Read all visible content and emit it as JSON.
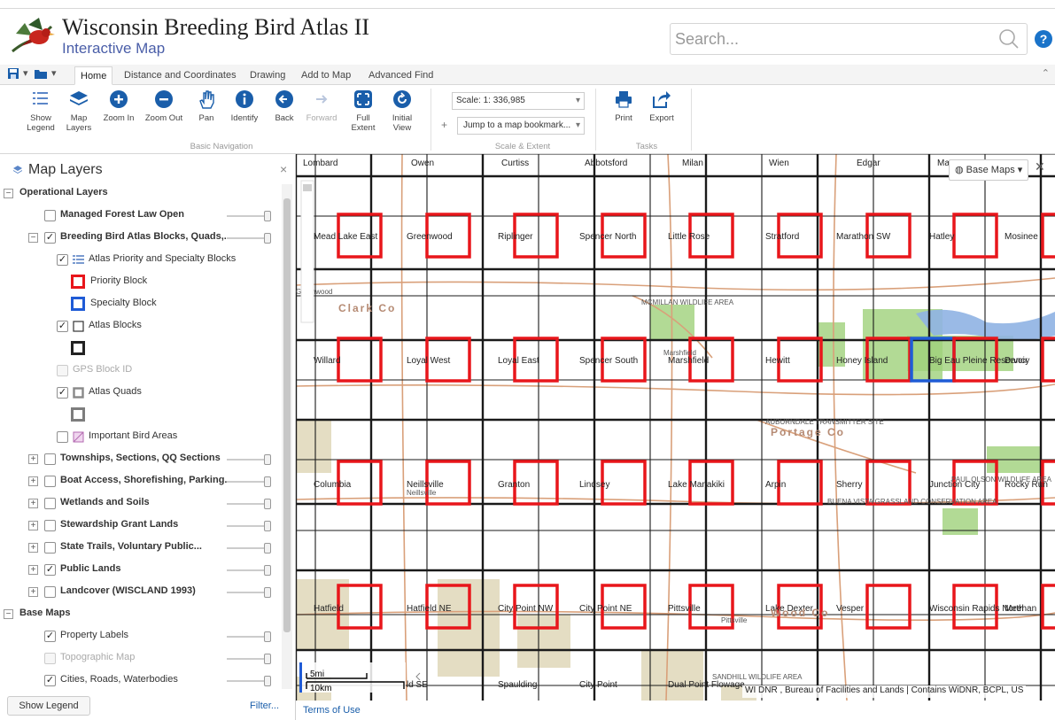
{
  "app": {
    "title": "Wisconsin Breeding Bird Atlas II",
    "subtitle": "Interactive Map"
  },
  "search": {
    "placeholder": "Search..."
  },
  "help": {
    "label": "?"
  },
  "tabs": [
    {
      "label": "Home"
    },
    {
      "label": "Distance and Coordinates"
    },
    {
      "label": "Drawing"
    },
    {
      "label": "Add to Map"
    },
    {
      "label": "Advanced Find"
    }
  ],
  "ribbon": {
    "nav": [
      {
        "label": "Show Legend",
        "icon": "legend-icon"
      },
      {
        "label": "Map Layers",
        "icon": "layers-icon"
      },
      {
        "label": "Zoom In",
        "icon": "zoom-in-icon"
      },
      {
        "label": "Zoom Out",
        "icon": "zoom-out-icon"
      },
      {
        "label": "Pan",
        "icon": "pan-hand-icon"
      },
      {
        "label": "Identify",
        "icon": "info-icon"
      },
      {
        "label": "Back",
        "icon": "back-arrow-icon"
      },
      {
        "label": "Forward",
        "icon": "forward-arrow-icon"
      },
      {
        "label": "Full Extent",
        "icon": "full-extent-icon"
      },
      {
        "label": "Initial View",
        "icon": "initial-view-icon"
      }
    ],
    "nav_group": "Basic Navigation",
    "scale_label": "Scale: 1:",
    "scale_value": "336,985",
    "bookmark": "Jump to a map bookmark...",
    "scale_group": "Scale & Extent",
    "tasks": [
      {
        "label": "Print",
        "icon": "print-icon"
      },
      {
        "label": "Export",
        "icon": "export-icon"
      }
    ],
    "tasks_group": "Tasks"
  },
  "panel": {
    "title": "Map Layers",
    "close": "×",
    "show_legend": "Show Legend",
    "filter": "Filter...",
    "rows": [
      {
        "type": "group",
        "label": "Operational Layers",
        "exp": "−"
      },
      {
        "type": "layer",
        "label": "Managed Forest Law Open",
        "checked": false,
        "slider": true
      },
      {
        "type": "layer",
        "label": "Breeding Bird Atlas Blocks, Quads,...",
        "checked": true,
        "slider": true,
        "exp": "−"
      },
      {
        "type": "sub",
        "label": "Atlas Priority and Specialty Blocks",
        "checked": true
      },
      {
        "type": "legend",
        "label": "Priority Block",
        "color": "#e8161b"
      },
      {
        "type": "legend",
        "label": "Specialty Block",
        "color": "#1f5bd6"
      },
      {
        "type": "sub",
        "label": "Atlas Blocks",
        "checked": true
      },
      {
        "type": "legend",
        "label": "",
        "color": "#222222"
      },
      {
        "type": "sub",
        "label": "GPS Block ID",
        "checked": false,
        "dim": true
      },
      {
        "type": "sub",
        "label": "Atlas Quads",
        "checked": true
      },
      {
        "type": "legend",
        "label": "",
        "color": "#7d7d7d"
      },
      {
        "type": "sub",
        "label": "Important Bird Areas",
        "checked": false
      },
      {
        "type": "layer",
        "label": "Townships, Sections, QQ Sections",
        "checked": false,
        "slider": true,
        "exp": "+"
      },
      {
        "type": "layer",
        "label": "Boat Access, Shorefishing, Parking...",
        "checked": false,
        "slider": true,
        "exp": "+"
      },
      {
        "type": "layer",
        "label": "Wetlands and Soils",
        "checked": false,
        "slider": true,
        "exp": "+"
      },
      {
        "type": "layer",
        "label": "Stewardship Grant Lands",
        "checked": false,
        "slider": true,
        "exp": "+"
      },
      {
        "type": "layer",
        "label": "State Trails, Voluntary Public...",
        "checked": false,
        "slider": true,
        "exp": "+"
      },
      {
        "type": "layer",
        "label": "Public Lands",
        "checked": true,
        "slider": true,
        "exp": "+"
      },
      {
        "type": "layer",
        "label": "Landcover (WISCLAND 1993)",
        "checked": false,
        "slider": true,
        "exp": "+"
      },
      {
        "type": "group",
        "label": "Base Maps",
        "exp": "−"
      },
      {
        "type": "base",
        "label": "Property Labels",
        "checked": true,
        "slider": true
      },
      {
        "type": "base",
        "label": "Topographic Map",
        "checked": false,
        "slider": true,
        "dim": true
      },
      {
        "type": "base",
        "label": "Cities, Roads, Waterbodies",
        "checked": true,
        "slider": true
      }
    ]
  },
  "map": {
    "basemaps_label": "Base Maps",
    "terms": "Terms of Use",
    "attribution": "WI DNR , Bureau of Facilities and Lands | Contains WiDNR, BCPL, US",
    "scalebar": {
      "mi": "5mi",
      "km": "10km"
    },
    "block_names": [
      [
        "Mead Lake East",
        "Greenwood",
        "Riplinger",
        "Spencer North",
        "Little Rose",
        "Stratford",
        "Marathon SW",
        "Hatley",
        "Mosinee"
      ],
      [
        "Willard",
        "Loyal West",
        "Loyal East",
        "Spencer South",
        "Marshfield",
        "Hewitt",
        "Honey Island",
        "Big Eau Pleine Reservoir",
        "Dancy"
      ],
      [
        "Columbia",
        "Neillsville",
        "Granton",
        "Lindsey",
        "Lake Manakiki",
        "Arpin",
        "Sherry",
        "Junction City",
        "Rocky Run"
      ],
      [
        "Hatfield",
        "Hatfield NE",
        "City Point NW",
        "City Point NE",
        "Pittsville",
        "Lake Dexter",
        "Vesper",
        "Wisconsin Rapids North",
        "Meehan"
      ],
      [
        "",
        "ld SE",
        "Spaulding",
        "City Point",
        "Dual Point Flowage",
        "",
        "",
        "",
        ""
      ]
    ],
    "top_towns": [
      "Lombard",
      "Owen",
      "Curtiss",
      "Abbotsford",
      "Milan",
      "Wien",
      "Edgar",
      "Ma"
    ],
    "labels": [
      "Clark Co",
      "Portage Co",
      "Wood Co",
      "AUBURNDALE TRANSMITTER SITE",
      "MCMILLAN WILDLIFE AREA",
      "PAUL OLSON WILDLIFE AREA",
      "BUENA VISTA GRASSLAND CONSERVATION AREA",
      "SANDHILL WILDLIFE AREA",
      "Greenwood",
      "Marshfield",
      "Pittsville",
      "Neillsville"
    ],
    "colors": {
      "priority": "#e8161b",
      "specialty": "#1f5bd6",
      "grid": "#1a1a1a",
      "road": "#d9a07a",
      "public": "#9fd17a",
      "urban": "#ddd4b4",
      "water": "#8fb2e3"
    }
  }
}
